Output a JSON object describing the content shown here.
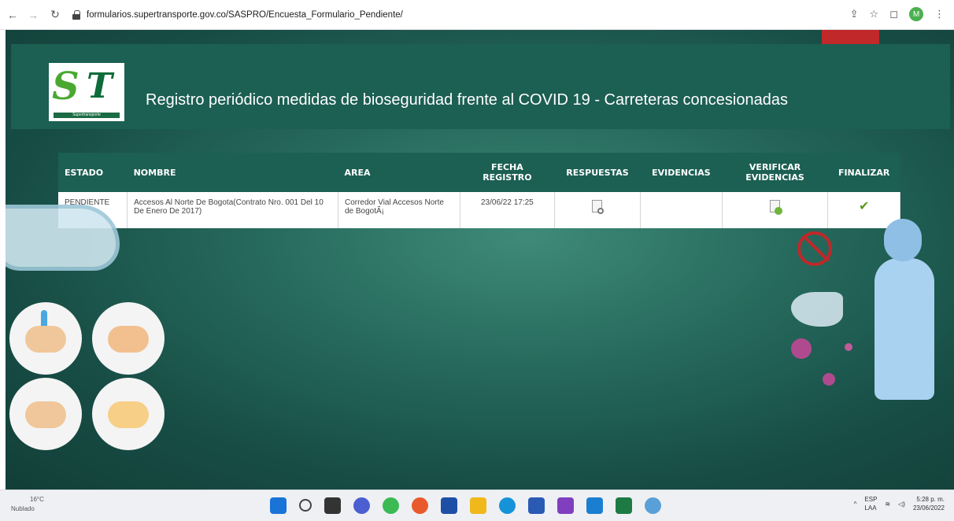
{
  "browser": {
    "url": "formularios.supertransporte.gov.co/SASPRO/Encuesta_Formulario_Pendiente/",
    "avatar_letter": "M"
  },
  "header": {
    "logo_text": "Supertransporte",
    "title": "Registro periódico medidas de bioseguridad frente al COVID 19 - Carreteras concesionadas"
  },
  "table": {
    "columns": [
      "ESTADO",
      "NOMBRE",
      "AREA",
      "FECHA REGISTRO",
      "RESPUESTAS",
      "EVIDENCIAS",
      "VERIFICAR EVIDENCIAS",
      "FINALIZAR"
    ],
    "rows": [
      {
        "estado": "PENDIENTE",
        "nombre": "Accesos Al Norte De Bogota(Contrato Nro. 001 Del 10 De Enero De 2017)",
        "area": "Corredor Vial Accesos Norte de BogotÃ¡",
        "fecha": "23/06/22 17:25",
        "respuestas_icon": "view-document-icon",
        "evidencias": "",
        "verificar_icon": "verify-document-icon",
        "finalizar_icon": "checkmark-icon"
      }
    ]
  },
  "taskbar": {
    "weather_temp": "16°C",
    "weather_desc": "Nublado",
    "lang": "ESP",
    "lang_sub": "LAA",
    "time": "5:28 p. m.",
    "date": "23/06/2022"
  },
  "colors": {
    "header_band": "#1c5f53",
    "page_bg": "#276b5e",
    "accent_red": "#c0282a",
    "check_green": "#5a9a1e"
  }
}
